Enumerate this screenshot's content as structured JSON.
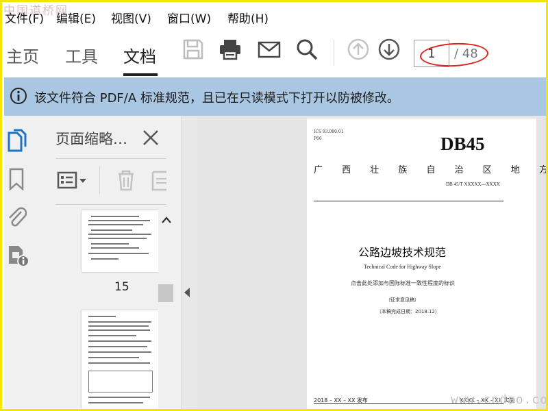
{
  "watermark_top": "中国道桥网",
  "watermark_bottom": "www.cndao.com",
  "menu": [
    "文件(F)",
    "编辑(E)",
    "视图(V)",
    "窗口(W)",
    "帮助(H)"
  ],
  "tabs": [
    "主页",
    "工具",
    "文档"
  ],
  "active_tab": "文档",
  "toolbar_icons": [
    "save-icon",
    "print-icon",
    "email-icon",
    "search-icon",
    "page-up-icon",
    "page-down-icon"
  ],
  "page_nav": {
    "current": "1",
    "total": "/ 48"
  },
  "info_bar": {
    "text": "该文件符合 PDF/A 标准规范，且已在只读模式下打开以防被修改。",
    "color": "#a9c7e2"
  },
  "left_rail_icons": [
    "pages-icon",
    "bookmark-icon",
    "attachment-icon",
    "security-icon"
  ],
  "thumbnails": {
    "title": "页面缩略…",
    "visible_page_label": "15"
  },
  "document": {
    "ics": "ICS 93.080.01",
    "class_code": "P66",
    "standard_id": "DB45",
    "standard_name": "广 西 壮 族 自 治 区 地 方 标 准",
    "code": "DB 45/T XXXXX—XXXX",
    "title_cn": "公路边坡技术规范",
    "title_en": "Technical Code for Highway Slope",
    "consistency_note": "点击此处添加与国际标准一致性程度的标识",
    "draft": "（征求意见稿）",
    "draft_date": "（本稿完成日期：2018.12）",
    "issue": "2018 – XX – XX 发布",
    "implement": "XXXX – XX – XX 实施"
  },
  "colors": {
    "accent_blue": "#1f73c6",
    "highlight_red": "#e0201c",
    "border_yellow": "#f5e600"
  }
}
